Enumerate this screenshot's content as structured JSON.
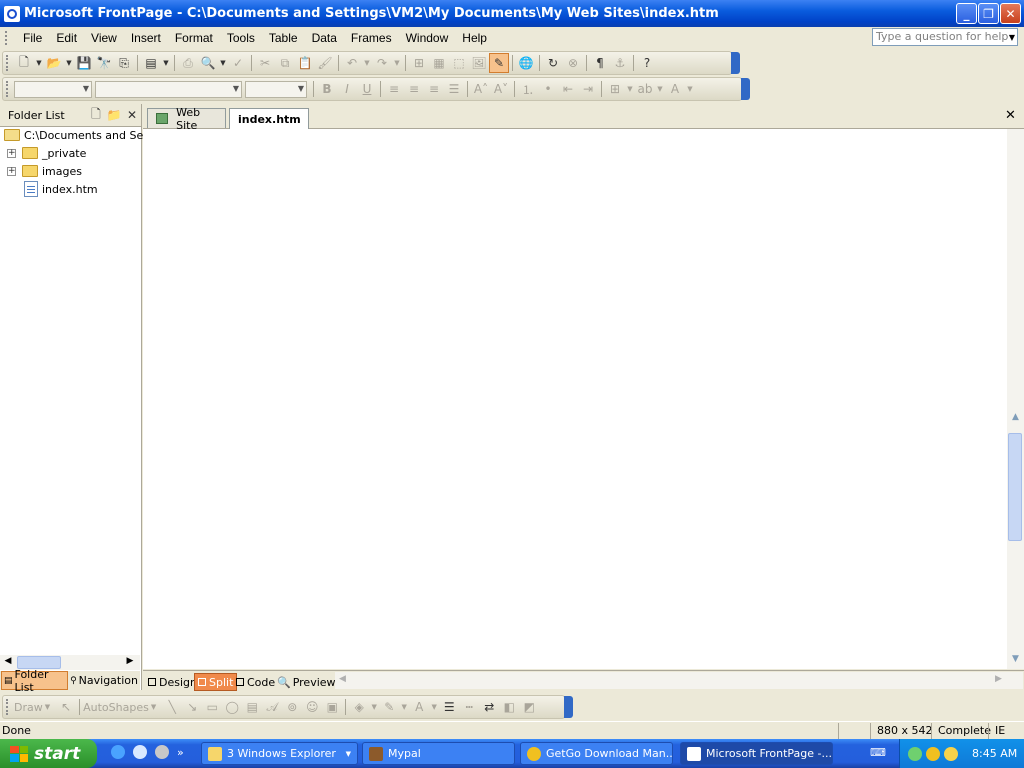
{
  "window": {
    "title": "Microsoft FrontPage - C:\\Documents and Settings\\VM2\\My Documents\\My Web Sites\\index.htm"
  },
  "menu": {
    "items": [
      "File",
      "Edit",
      "View",
      "Insert",
      "Format",
      "Tools",
      "Table",
      "Data",
      "Frames",
      "Window",
      "Help"
    ],
    "help_placeholder": "Type a question for help"
  },
  "folder_list": {
    "title": "Folder List",
    "root": "C:\\Documents and Setti",
    "items": [
      {
        "label": "_private",
        "type": "folder"
      },
      {
        "label": "images",
        "type": "folder"
      },
      {
        "label": "index.htm",
        "type": "page"
      }
    ],
    "bottom_tabs": [
      "Folder List",
      "Navigation"
    ]
  },
  "document": {
    "tabs": [
      {
        "label": "Web Site",
        "active": false
      },
      {
        "label": "index.htm",
        "active": true
      }
    ],
    "view_tabs": [
      {
        "label": "Design",
        "active": false
      },
      {
        "label": "Split",
        "active": true
      },
      {
        "label": "Code",
        "active": false
      },
      {
        "label": "Preview",
        "active": false
      }
    ]
  },
  "drawing_toolbar": {
    "draw_label": "Draw",
    "autoshapes_label": "AutoShapes"
  },
  "status": {
    "left": "Done",
    "size": "880 x 542",
    "mode": "Complete",
    "browser": "IE"
  },
  "taskbar": {
    "start": "start",
    "tasks": [
      {
        "label": "3 Windows Explorer",
        "active": false
      },
      {
        "label": "Mypal",
        "active": false
      },
      {
        "label": "GetGo Download Man...",
        "active": false
      },
      {
        "label": "Microsoft FrontPage -...",
        "active": true
      }
    ],
    "chevron": "»",
    "clock": "8:45 AM"
  },
  "colors": {
    "titlebar": "#0A5CDE",
    "chrome": "#ECE9D8",
    "taskbar": "#245EDC",
    "start": "#2A8F2A",
    "active_view_tab": "#F08A4B"
  }
}
